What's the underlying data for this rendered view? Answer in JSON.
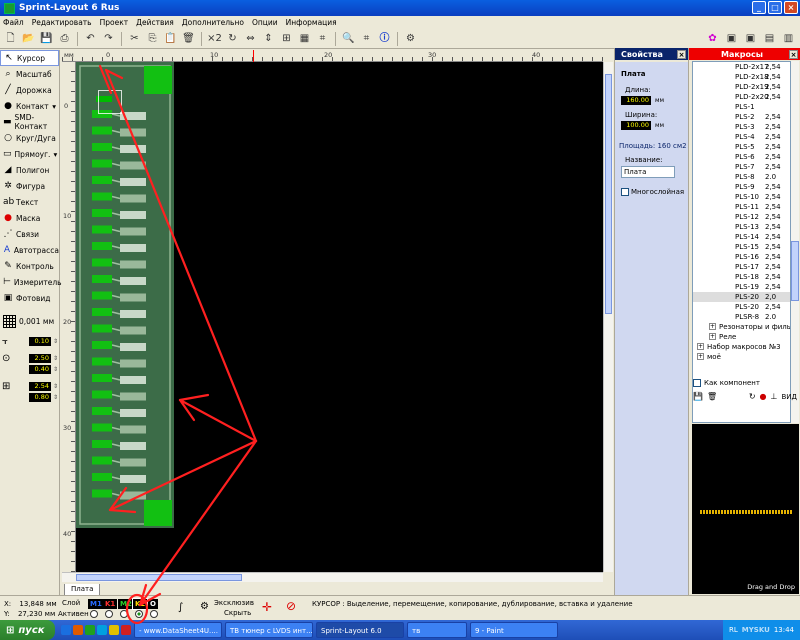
{
  "window": {
    "title": "Sprint-Layout 6 Rus"
  },
  "menu": [
    "Файл",
    "Редактировать",
    "Проект",
    "Действия",
    "Дополнительно",
    "Опции",
    "Информация"
  ],
  "tools": [
    {
      "label": "Курсор",
      "icon": "cursor-icon",
      "glyph": "↖",
      "active": true
    },
    {
      "label": "Масштаб",
      "icon": "zoom-icon",
      "glyph": "⌕"
    },
    {
      "label": "Дорожка",
      "icon": "track-icon",
      "glyph": "╱"
    },
    {
      "label": "Контакт",
      "icon": "pad-icon",
      "glyph": "●",
      "dropdown": true
    },
    {
      "label": "SMD-Контакт",
      "icon": "smd-pad-icon",
      "glyph": "▬"
    },
    {
      "label": "Круг/Дуга",
      "icon": "circle-icon",
      "glyph": "○"
    },
    {
      "label": "Прямоуг.",
      "icon": "rectangle-icon",
      "glyph": "▭",
      "dropdown": true
    },
    {
      "label": "Полигон",
      "icon": "polygon-icon",
      "glyph": "◢"
    },
    {
      "label": "Фигура",
      "icon": "figure-icon",
      "glyph": "✲"
    },
    {
      "label": "Текст",
      "icon": "text-icon",
      "glyph": "ab"
    },
    {
      "label": "Маска",
      "icon": "mask-icon",
      "glyph": "●"
    },
    {
      "label": "Связи",
      "icon": "connections-icon",
      "glyph": "⋰"
    },
    {
      "label": "Автотрасса",
      "icon": "autoroute-icon",
      "glyph": "A"
    },
    {
      "label": "Контроль",
      "icon": "control-icon",
      "glyph": "✎"
    },
    {
      "label": "Измеритель",
      "icon": "measure-icon",
      "glyph": "⊢"
    },
    {
      "label": "Фотовид",
      "icon": "photoview-icon",
      "glyph": "▣"
    }
  ],
  "grid": {
    "value": "0,001 мм"
  },
  "widths": {
    "track": "0.10",
    "pad_outer": "2.50",
    "pad_inner": "0.40",
    "smd_w": "2.54",
    "smd_h": "0.80"
  },
  "ruler": {
    "top": [
      "мм",
      "0",
      "10",
      "20",
      "30",
      "40"
    ],
    "left": [
      "0",
      "10",
      "20",
      "30",
      "40"
    ]
  },
  "board_tab": "Плата",
  "properties": {
    "header": "Свойства",
    "title": "Плата",
    "length_label": "Длина:",
    "length_value": "160.00",
    "length_unit": "мм",
    "width_label": "Ширина:",
    "width_value": "100.00",
    "width_unit": "мм",
    "area": "Площадь: 160 см2",
    "name_label": "Название:",
    "name_value": "Плата",
    "multilayer": "Многослойная"
  },
  "macros": {
    "header": "Макросы",
    "items": [
      {
        "name": "PLD-2x17",
        "pitch": "2,54"
      },
      {
        "name": "PLD-2x18",
        "pitch": "2,54"
      },
      {
        "name": "PLD-2x19",
        "pitch": "2,54"
      },
      {
        "name": "PLD-2x20",
        "pitch": "2,54"
      },
      {
        "name": "PLS-1",
        "pitch": ""
      },
      {
        "name": "PLS-2",
        "pitch": "2,54"
      },
      {
        "name": "PLS-3",
        "pitch": "2,54"
      },
      {
        "name": "PLS-4",
        "pitch": "2,54"
      },
      {
        "name": "PLS-5",
        "pitch": "2,54"
      },
      {
        "name": "PLS-6",
        "pitch": "2,54"
      },
      {
        "name": "PLS-7",
        "pitch": "2,54"
      },
      {
        "name": "PLS-8",
        "pitch": "2.0"
      },
      {
        "name": "PLS-9",
        "pitch": "2,54"
      },
      {
        "name": "PLS-10",
        "pitch": "2,54"
      },
      {
        "name": "PLS-11",
        "pitch": "2,54"
      },
      {
        "name": "PLS-12",
        "pitch": "2,54"
      },
      {
        "name": "PLS-13",
        "pitch": "2,54"
      },
      {
        "name": "PLS-14",
        "pitch": "2,54"
      },
      {
        "name": "PLS-15",
        "pitch": "2,54"
      },
      {
        "name": "PLS-16",
        "pitch": "2,54"
      },
      {
        "name": "PLS-17",
        "pitch": "2,54"
      },
      {
        "name": "PLS-18",
        "pitch": "2,54"
      },
      {
        "name": "PLS-19",
        "pitch": "2,54"
      },
      {
        "name": "PLS-20",
        "pitch": "2,0",
        "selected": true
      },
      {
        "name": "PLS-20",
        "pitch": "2,54"
      },
      {
        "name": "PLSR-8",
        "pitch": "2.0"
      }
    ],
    "groups": [
      {
        "label": "Резонаторы и фильтры",
        "indent": 2
      },
      {
        "label": "Реле",
        "indent": 2
      },
      {
        "label": "Набор макросов №3",
        "indent": 0
      },
      {
        "label": "моё",
        "indent": 0
      }
    ],
    "as_component": "Как компонент",
    "view": "ВИД",
    "drag_drop": "Drag and Drop"
  },
  "status": {
    "x_label": "X:",
    "x_value": "13,848 мм",
    "y_label": "Y:",
    "y_value": "27,230 мм",
    "layer_label": "Слой",
    "active_label": "Активен",
    "layers": [
      {
        "name": "M1",
        "color": "#2a6cff"
      },
      {
        "name": "K1",
        "color": "#ff3030"
      },
      {
        "name": "M2",
        "color": "#2bd12b"
      },
      {
        "name": "K2",
        "color": "#ffd700"
      },
      {
        "name": "O",
        "color": "#ffffff"
      }
    ],
    "exclusive": "Эксклюзив",
    "hide": "Скрыть",
    "message": "КУРСОР : Выделение, перемещение, копирование, дублирование, вставка и удаление"
  },
  "taskbar": {
    "start": "пуск",
    "tasks": [
      {
        "label": "- www.DataSheet4U....",
        "active": false
      },
      {
        "label": "ТВ тюнер с LVDS инт...",
        "active": false
      },
      {
        "label": "Sprint-Layout 6.0",
        "active": true
      },
      {
        "label": "тв",
        "active": false
      },
      {
        "label": "9 - Paint",
        "active": false
      }
    ],
    "lang": "RL",
    "watermark": "MYSKU",
    "time": "13:44"
  },
  "colors": {
    "pcb_green": "#3c6c48",
    "pad_green": "#12c012",
    "arrow_red": "#ff2020",
    "macros_header": "#ee0000"
  }
}
